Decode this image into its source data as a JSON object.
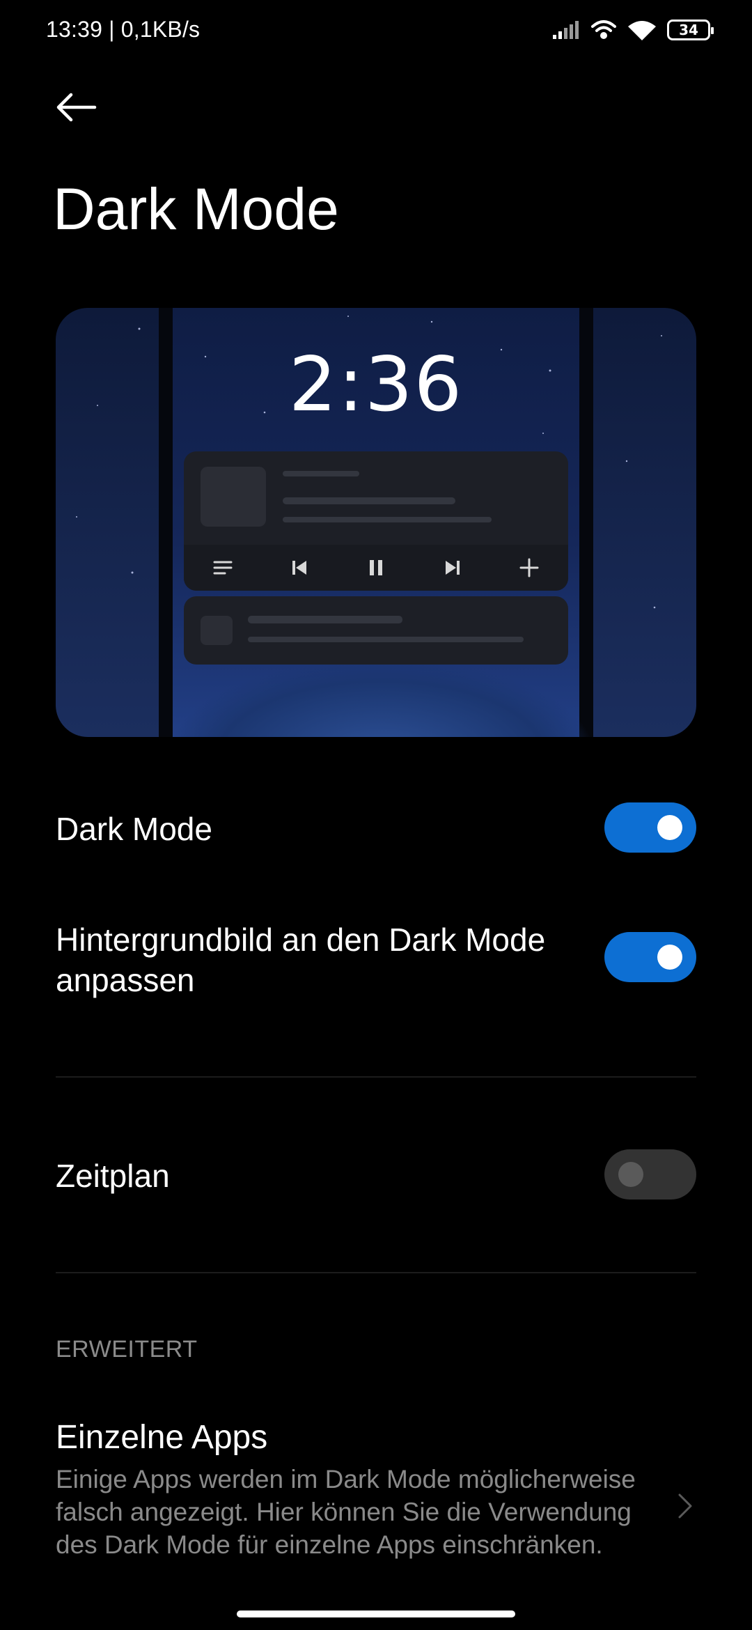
{
  "status_bar": {
    "time_speed": "13:39 | 0,1KB/s",
    "battery_level": "34",
    "icons": [
      "signal-icon",
      "hotspot-icon",
      "wifi-icon",
      "battery-icon"
    ]
  },
  "header": {
    "back_icon": "arrow-left-icon",
    "title": "Dark Mode"
  },
  "preview": {
    "clock": "2:36",
    "media_controls": [
      "list-icon",
      "skip-previous-icon",
      "pause-icon",
      "skip-next-icon",
      "plus-icon"
    ]
  },
  "settings": {
    "dark_mode": {
      "label": "Dark Mode",
      "enabled": true
    },
    "wallpaper_adapt": {
      "label": "Hintergrundbild an den Dark Mode anpassen",
      "enabled": true
    },
    "schedule": {
      "label": "Zeitplan",
      "enabled": false
    }
  },
  "advanced": {
    "header": "ERWEITERT",
    "apps_title": "Einzelne Apps",
    "apps_description": "Einige Apps werden im Dark Mode möglicherweise falsch angezeigt. Hier können Sie die Verwendung des Dark Mode für einzelne Apps einschränken.",
    "chevron_icon": "chevron-right-icon"
  },
  "colors": {
    "background": "#000000",
    "accent": "#0d6fd3",
    "secondary_text": "#8a8a8a"
  }
}
